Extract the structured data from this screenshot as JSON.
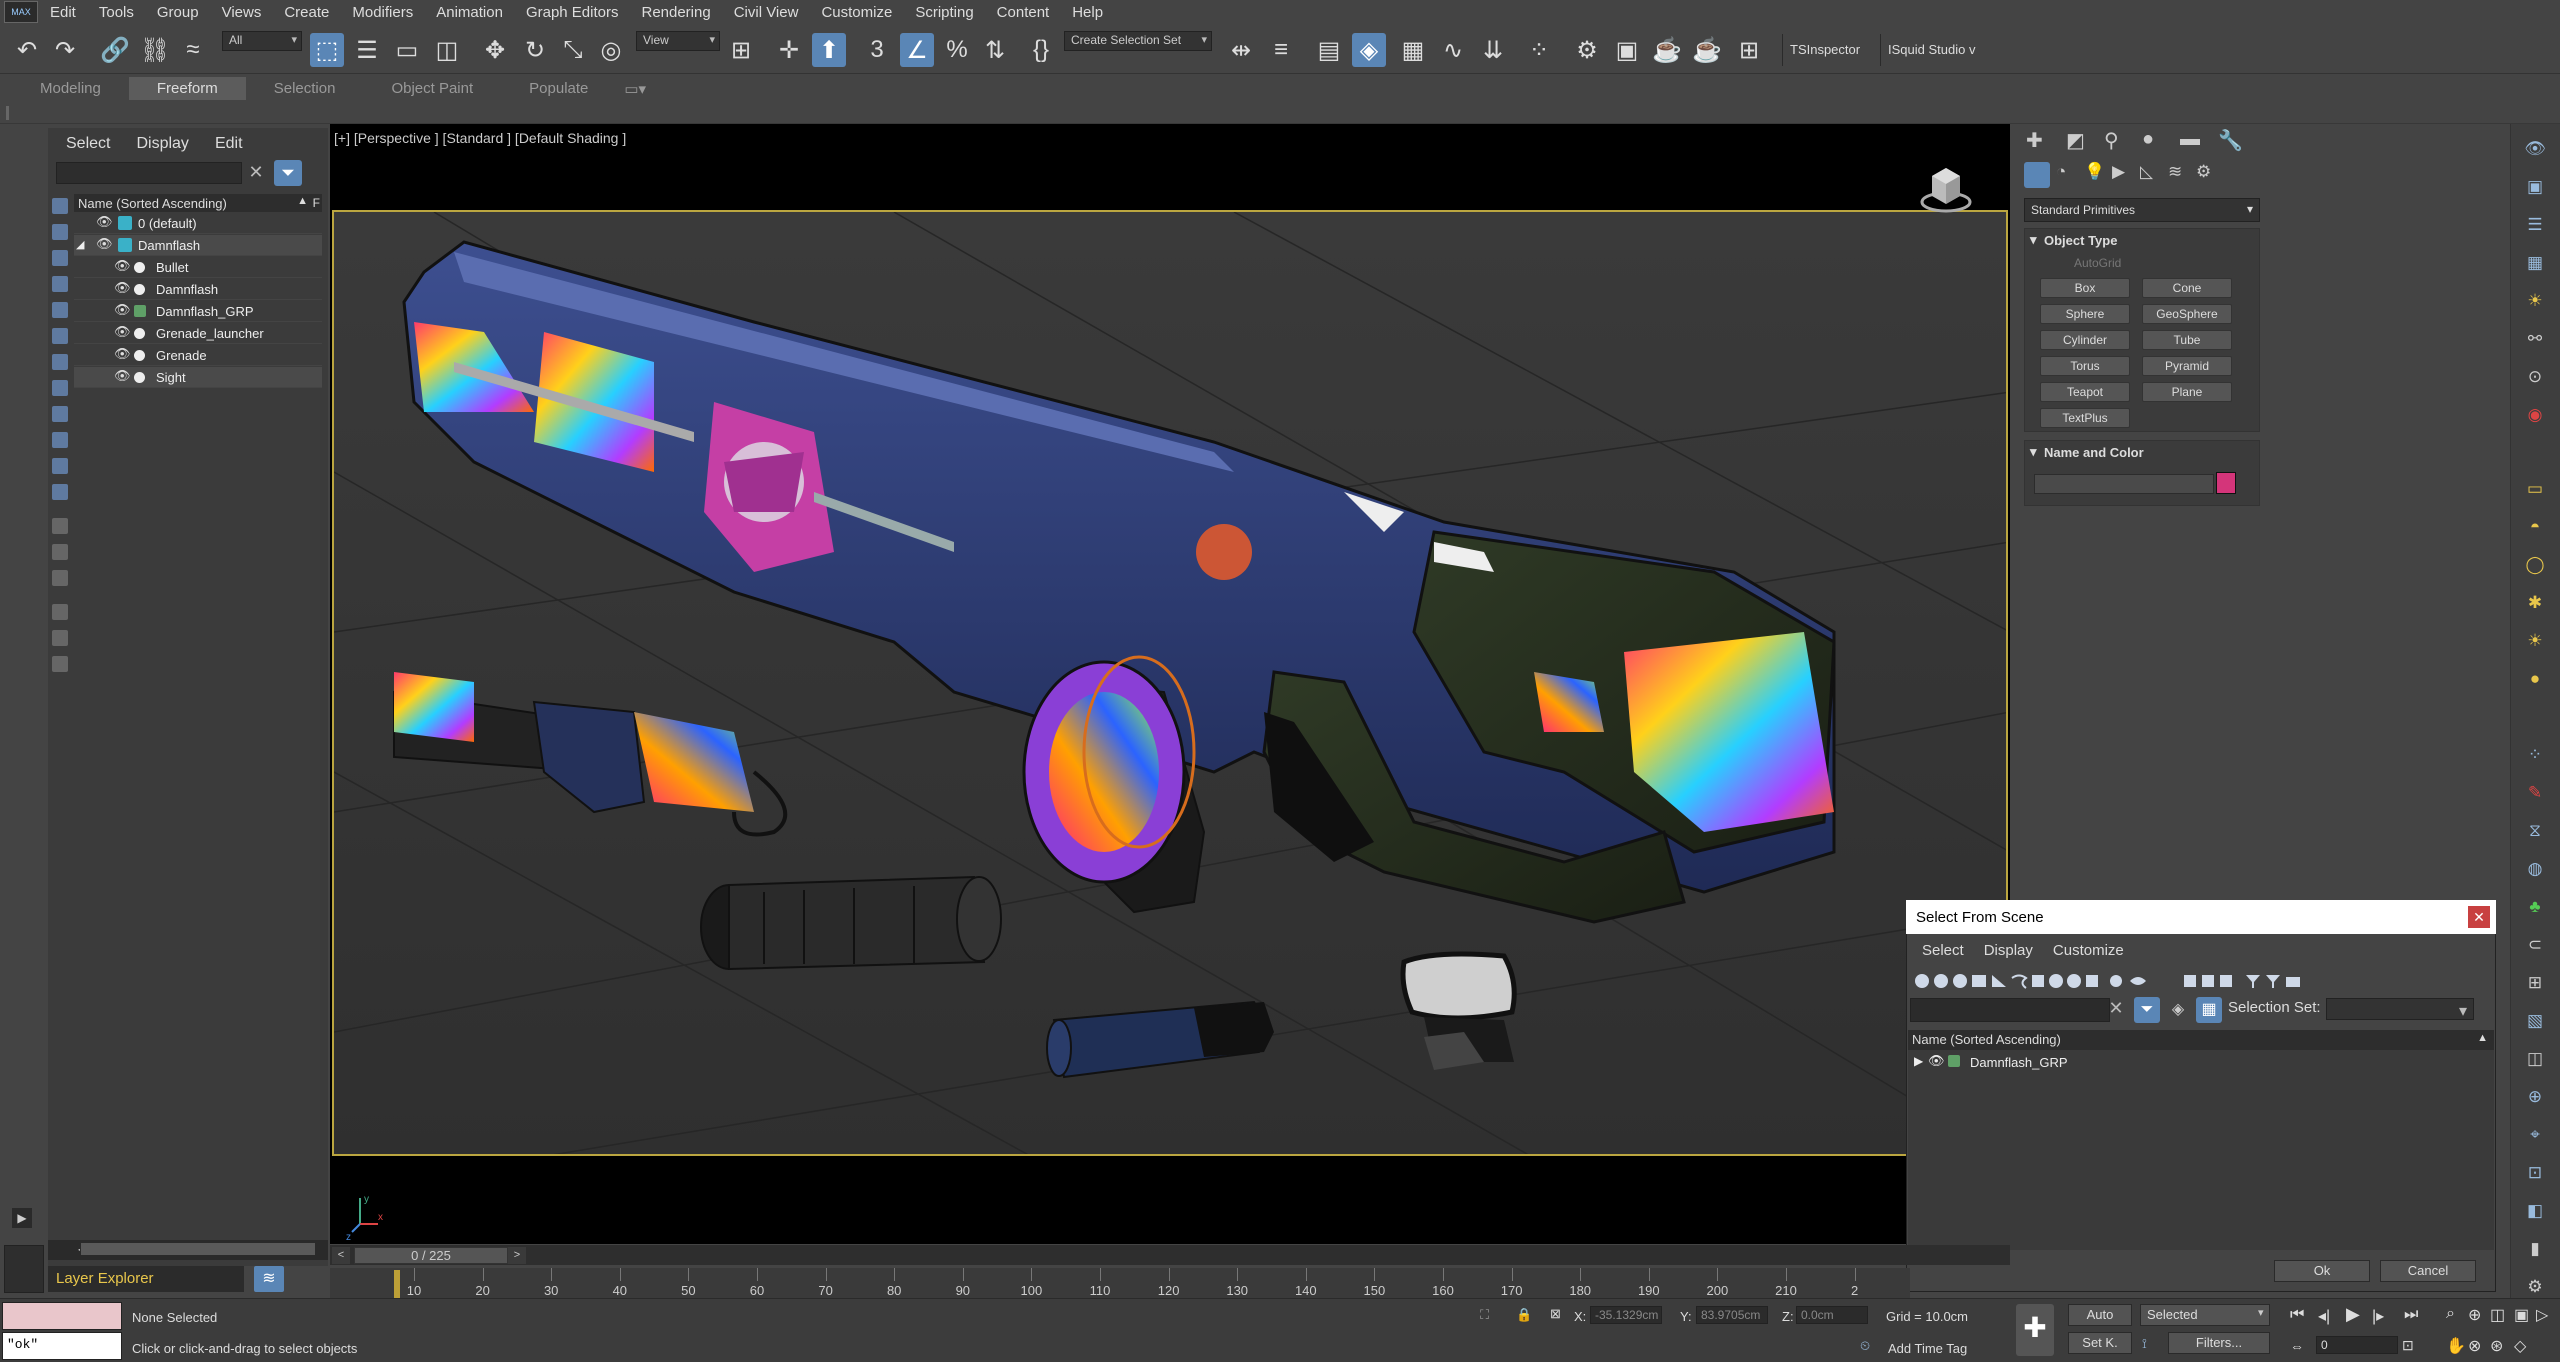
{
  "app": {
    "logo": "MAX"
  },
  "menu": [
    "Edit",
    "Tools",
    "Group",
    "Views",
    "Create",
    "Modifiers",
    "Animation",
    "Graph Editors",
    "Rendering",
    "Civil View",
    "Customize",
    "Scripting",
    "Content",
    "Help"
  ],
  "toolbar": {
    "filter_value": "All",
    "refcoord_value": "View",
    "selection_set_value": "Create Selection Set",
    "plugin1": "TSInspector",
    "plugin2": "ISquid Studio v"
  },
  "ribbon_tabs": [
    "Modeling",
    "Freeform",
    "Selection",
    "Object Paint",
    "Populate"
  ],
  "ribbon_active": "Freeform",
  "scene_explorer": {
    "menu": [
      "Select",
      "Display",
      "Edit"
    ],
    "column": "Name (Sorted Ascending)",
    "column_f": "F",
    "rows": [
      {
        "label": "0 (default)"
      },
      {
        "label": "Damnflash"
      },
      {
        "label": "Bullet"
      },
      {
        "label": "Damnflash"
      },
      {
        "label": "Damnflash_GRP"
      },
      {
        "label": "Grenade_launcher"
      },
      {
        "label": "Grenade"
      },
      {
        "label": "Sight"
      }
    ],
    "layer_explorer": "Layer Explorer"
  },
  "viewport": {
    "label": "[+] [Perspective ] [Standard ] [Default Shading ]"
  },
  "timeline": {
    "slider": "0 / 225",
    "ticks": [
      "10",
      "20",
      "30",
      "40",
      "50",
      "60",
      "70",
      "80",
      "90",
      "100",
      "110",
      "120",
      "130",
      "140",
      "150",
      "160",
      "170",
      "180",
      "190",
      "200",
      "210",
      "2"
    ]
  },
  "command_panel": {
    "dropdown": "Standard Primitives",
    "object_type_header": "Object Type",
    "autogrid": "AutoGrid",
    "buttons": [
      "Box",
      "Cone",
      "Sphere",
      "GeoSphere",
      "Cylinder",
      "Tube",
      "Torus",
      "Pyramid",
      "Teapot",
      "Plane",
      "TextPlus"
    ],
    "name_color_header": "Name and Color",
    "color": "#d4357a"
  },
  "dialog": {
    "title": "Select From Scene",
    "menu": [
      "Select",
      "Display",
      "Customize"
    ],
    "selection_set_label": "Selection Set:",
    "column": "Name (Sorted Ascending)",
    "row": "Damnflash_GRP",
    "ok": "Ok",
    "cancel": "Cancel"
  },
  "status": {
    "maxscript_output": "\"ok\"",
    "selection": "None Selected",
    "prompt": "Click or click-and-drag to select objects",
    "x_label": "X:",
    "x_value": "-35.1329cm",
    "y_label": "Y:",
    "y_value": "83.9705cm",
    "z_label": "Z:",
    "z_value": "0.0cm",
    "grid": "Grid = 10.0cm",
    "add_time_tag": "Add Time Tag",
    "auto": "Auto",
    "setk": "Set K.",
    "selected": "Selected",
    "filters": "Filters...",
    "frame": "0"
  }
}
